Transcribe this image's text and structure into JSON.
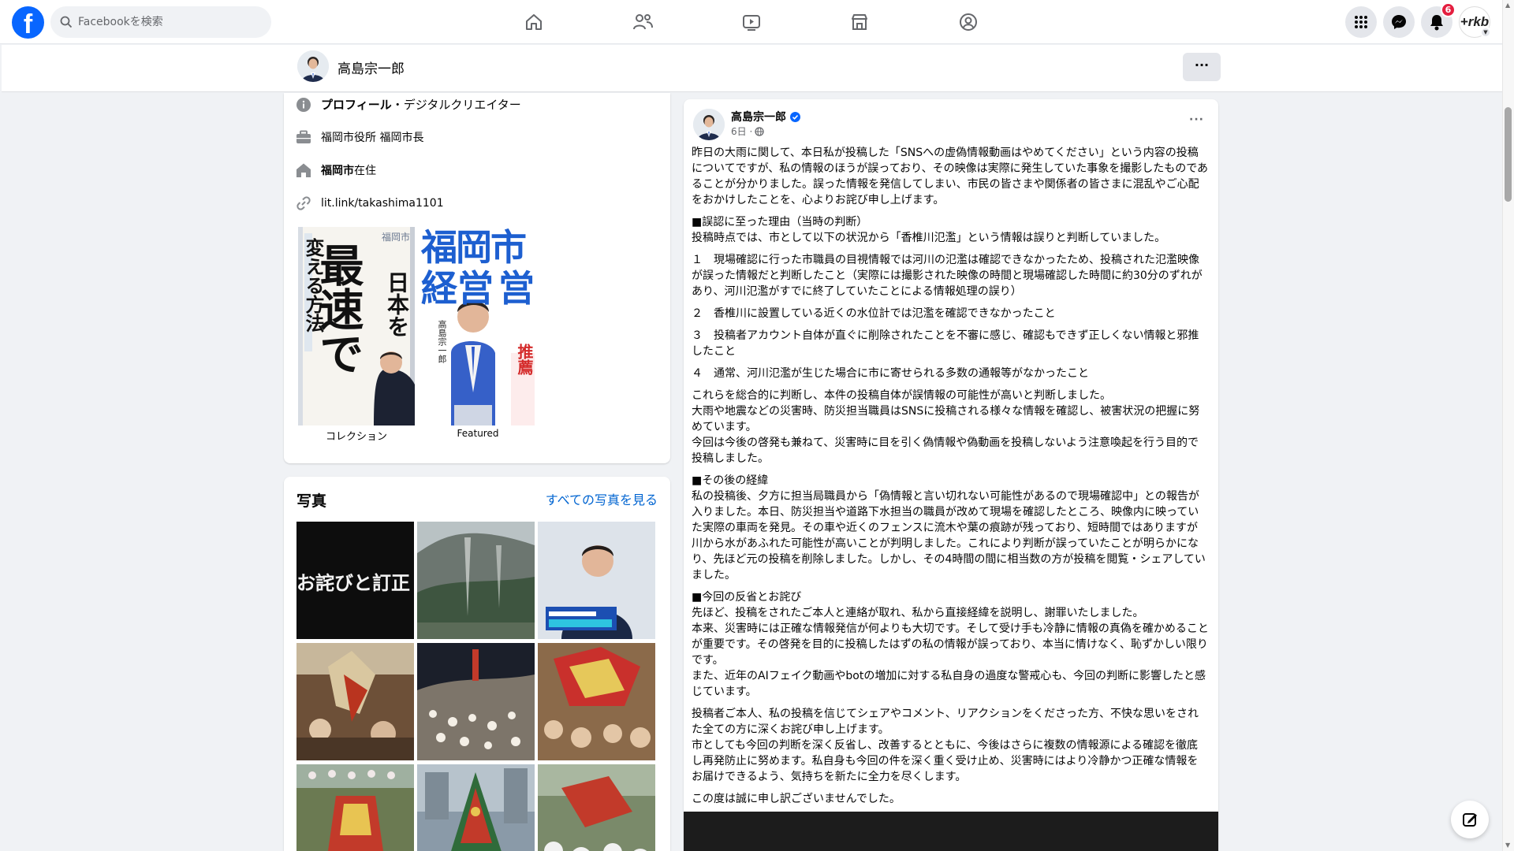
{
  "nav": {
    "search_placeholder": "Facebookを検索",
    "notifications_count": "6",
    "account_label": "+rkb"
  },
  "subheader": {
    "name": "高島宗一郎",
    "more_label": "···"
  },
  "intro": {
    "profile_bold": "プロフィール",
    "profile_rest": "・デジタルクリエイター",
    "work": "福岡市役所 福岡市長",
    "lives_bold": "福岡市",
    "lives_rest": "在住",
    "link": "lit.link/takashima1101",
    "book1": {
      "caption": "コレクション",
      "title_line1": "変える方法",
      "title_big": "最速で",
      "title_side": "日本を",
      "top_text": "福岡市"
    },
    "book2": {
      "caption": "Featured",
      "title": "福岡市",
      "title2": "経営",
      "title3": "営",
      "author": "高島宗一郎",
      "tag": "推薦"
    }
  },
  "photos": {
    "title": "写真",
    "see_all": "すべての写真を見る",
    "first_text": "お詫びと訂正"
  },
  "post": {
    "author": "高島宗一郎",
    "time": "6日 ·",
    "more_label": "···",
    "paragraphs": [
      "昨日の大雨に関して、本日私が投稿した「SNSへの虚偽情報動画はやめてください」という内容の投稿についてですが、私の情報のほうが誤っており、その映像は実際に発生していた事象を撮影したものであることが分かりました。誤った情報を発信してしまい、市民の皆さまや関係者の皆さまに混乱やご心配をおかけしたことを、心よりお詫び申し上げます。",
      "■誤認に至った理由（当時の判断）\n投稿時点では、市として以下の状況から「香椎川氾濫」という情報は誤りと判断していました。",
      "１　現場確認に行った市職員の目視情報では河川の氾濫は確認できなかったため、投稿された氾濫映像が誤った情報だと判断したこと（実際には撮影された映像の時間と現場確認した時間に約30分のずれがあり、河川氾濫がすでに終了していたことによる情報処理の誤り）",
      "２　香椎川に設置している近くの水位計では氾濫を確認できなかったこと",
      "３　投稿者アカウント自体が直ぐに削除されたことを不審に感じ、確認もできず正しくない情報と邪推したこと",
      "４　通常、河川氾濫が生じた場合に市に寄せられる多数の通報等がなかったこと",
      "これらを総合的に判断し、本件の投稿自体が誤情報の可能性が高いと判断しました。\n大雨や地震などの災害時、防災担当職員はSNSに投稿される様々な情報を確認し、被害状況の把握に努めています。\n今回は今後の啓発も兼ねて、災害時に目を引く偽情報や偽動画を投稿しないよう注意喚起を行う目的で投稿しました。",
      "■その後の経緯\n私の投稿後、夕方に担当局職員から「偽情報と言い切れない可能性があるので現場確認中」との報告が入りました。本日、防災担当や道路下水担当の職員が改めて現場を確認したところ、映像内に映っていた実際の車両を発見。その車や近くのフェンスに流木や葉の痕跡が残っており、短時間ではありますが川から水があふれた可能性が高いことが判明しました。これにより判断が誤っていたことが明らかになり、先ほど元の投稿を削除しました。しかし、その4時間の間に相当数の方が投稿を閲覧・シェアしていました。",
      "■今回の反省とお詫び\n先ほど、投稿をされたご本人と連絡が取れ、私から直接経緯を説明し、謝罪いたしました。\n本来、災害時には正確な情報発信が何よりも大切です。そして受け手も冷静に情報の真偽を確かめることが重要です。その啓発を目的に投稿したはずの私の情報が誤っており、本当に情けなく、恥ずかしい限りです。\nまた、近年のAIフェイク動画やbotの増加に対する私自身の過度な警戒心も、今回の判断に影響したと感じています。",
      "投稿者ご本人、私の投稿を信じてシェアやコメント、リアクションをくださった方、不快な思いをされた全ての方に深くお詫び申し上げます。\n市としても今回の判断を深く反省し、改善するとともに、今後はさらに複数の情報源による確認を徹底し再発防止に努めます。私自身も今回の件を深く重く受け止め、災害時にはより冷静かつ正確な情報をお届けできるよう、気持ちを新たに全力を尽くします。",
      "この度は誠に申し訳ございませんでした。"
    ]
  },
  "colors": {
    "brand": "#0866ff",
    "link": "#0064d1",
    "badge": "#e41e3f",
    "page_bg": "#f0f2f5"
  },
  "icons": [
    "facebook-logo-icon",
    "search-icon",
    "home-icon",
    "friends-icon",
    "video-icon",
    "marketplace-icon",
    "groups-icon",
    "menu-grid-icon",
    "messenger-icon",
    "bell-icon",
    "info-icon",
    "briefcase-icon",
    "house-icon",
    "link-icon",
    "verified-icon",
    "globe-icon",
    "compose-icon"
  ]
}
